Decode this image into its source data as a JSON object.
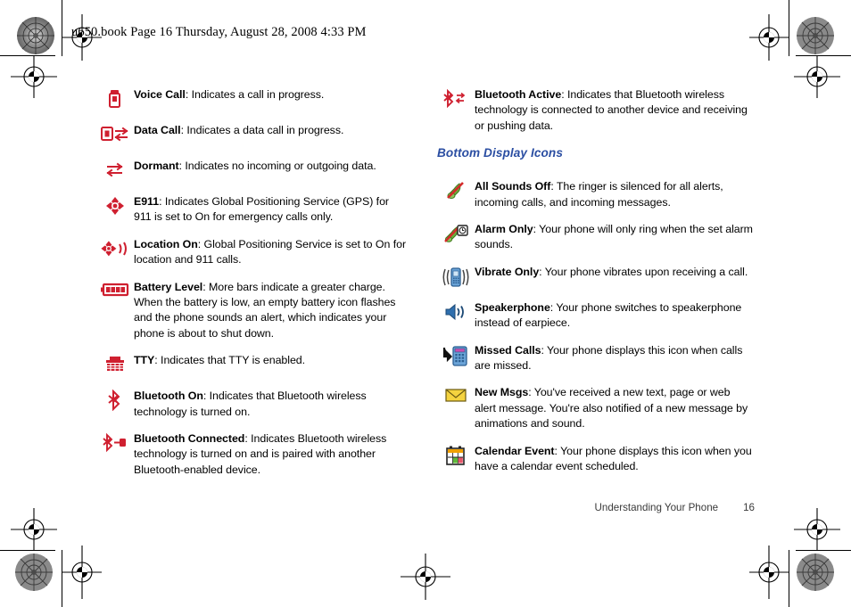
{
  "document": {
    "header_line": "u650.book  Page 16  Thursday, August 28, 2008  4:33 PM",
    "footer_title": "Understanding Your Phone",
    "footer_page": "16"
  },
  "colors": {
    "icon_red": "#cf2030",
    "heading_blue": "#2b4ea2",
    "text_black": "#000000",
    "icon_green": "#4f9d2a",
    "icon_blue": "#4a90d9",
    "icon_yellow": "#f5d33f",
    "icon_orange": "#f0a000"
  },
  "left_column": {
    "entries": [
      {
        "icon": "voice-call-icon",
        "term": "Voice Call",
        "description": ": Indicates a call in progress."
      },
      {
        "icon": "data-call-icon",
        "term": "Data Call",
        "description": ": Indicates a data call in progress."
      },
      {
        "icon": "dormant-icon",
        "term": "Dormant",
        "description": ": Indicates no incoming or outgoing data."
      },
      {
        "icon": "e911-icon",
        "term": "E911",
        "description": ": Indicates Global Positioning Service (GPS) for 911 is set to On for emergency calls only."
      },
      {
        "icon": "location-on-icon",
        "term": "Location On",
        "description": ": Global Positioning Service is set to On for location and 911 calls."
      },
      {
        "icon": "battery-level-icon",
        "term": "Battery Level",
        "description": ": More bars indicate a greater charge. When the battery is low, an empty battery icon flashes and the phone sounds an alert, which indicates your phone is about to shut down."
      },
      {
        "icon": "tty-icon",
        "term": "TTY",
        "description": ": Indicates that TTY is enabled."
      },
      {
        "icon": "bluetooth-on-icon",
        "term": "Bluetooth On",
        "description": ": Indicates that Bluetooth wireless technology is turned on."
      },
      {
        "icon": "bluetooth-connected-icon",
        "term": "Bluetooth Connected",
        "description": ": Indicates Bluetooth wireless technology is turned on and is paired with another Bluetooth-enabled device."
      }
    ]
  },
  "right_column": {
    "top_entries": [
      {
        "icon": "bluetooth-active-icon",
        "term": "Bluetooth Active",
        "description": ": Indicates that Bluetooth wireless technology is connected to another device and receiving or pushing data."
      }
    ],
    "section_heading": "Bottom Display Icons",
    "bottom_entries": [
      {
        "icon": "all-sounds-off-icon",
        "term": "All Sounds Off",
        "description": ": The ringer is silenced for all alerts, incoming calls, and incoming messages."
      },
      {
        "icon": "alarm-only-icon",
        "term": "Alarm Only",
        "description": ": Your phone will only ring when the set alarm sounds."
      },
      {
        "icon": "vibrate-only-icon",
        "term": "Vibrate Only",
        "description": ": Your phone vibrates upon receiving a call."
      },
      {
        "icon": "speakerphone-icon",
        "term": "Speakerphone",
        "description": ": Your phone switches to speakerphone instead of earpiece."
      },
      {
        "icon": "missed-calls-icon",
        "term": "Missed Calls",
        "description": ": Your phone displays this icon when calls are missed."
      },
      {
        "icon": "new-msgs-icon",
        "term": "New Msgs",
        "description": ": You've received a new text, page or web alert message. You're also notified of a new message by animations and sound."
      },
      {
        "icon": "calendar-event-icon",
        "term": "Calendar Event",
        "description": ": Your phone displays this icon when you have a calendar event scheduled."
      }
    ]
  }
}
